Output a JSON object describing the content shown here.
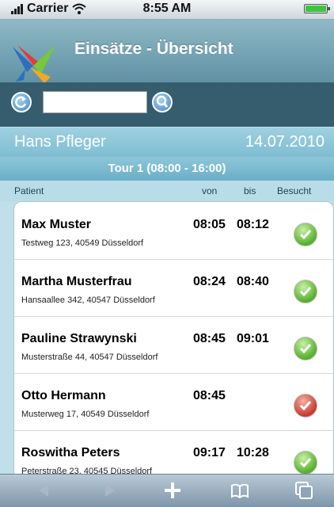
{
  "status_bar": {
    "carrier": "Carrier",
    "time": "8:55 AM"
  },
  "header": {
    "title": "Einsätze - Übersicht"
  },
  "search": {
    "value": "",
    "placeholder": ""
  },
  "nurse": {
    "name": "Hans Pfleger",
    "date": "14.07.2010"
  },
  "tour": {
    "label": "Tour 1 (08:00 - 16:00)"
  },
  "columns": {
    "patient": "Patient",
    "von": "von",
    "bis": "bis",
    "besucht": "Besucht"
  },
  "patients": [
    {
      "name": "Max Muster",
      "address": "Testweg 123, 40549 Düsseldorf",
      "von": "08:05",
      "bis": "08:12",
      "visited": true
    },
    {
      "name": "Martha Musterfrau",
      "address": "Hansaallee 342, 40547 Düsseldorf",
      "von": "08:24",
      "bis": "08:40",
      "visited": true
    },
    {
      "name": "Pauline Strawynski",
      "address": "Musterstraße 44, 40547 Düsseldorf",
      "von": "08:45",
      "bis": "09:01",
      "visited": true
    },
    {
      "name": "Otto Hermann",
      "address": "Musterweg 17, 40549 Düsseldorf",
      "von": "08:45",
      "bis": "",
      "visited": false
    },
    {
      "name": "Roswitha Peters",
      "address": "Peterstraße 23, 40545 Düsseldorf",
      "von": "09:17",
      "bis": "10:28",
      "visited": true
    }
  ],
  "icons": {
    "refresh": "refresh-icon",
    "search": "search-icon",
    "check": "check-icon",
    "toolbar": [
      "back-arrow-icon",
      "forward-arrow-icon",
      "plus-icon",
      "bookmarks-icon",
      "pages-icon"
    ]
  },
  "colors": {
    "header": "#5f92a4",
    "searchbar": "#365d6d",
    "tour": "#6aaec6",
    "visited": "#55b02b",
    "not_visited": "#c73a2d"
  }
}
